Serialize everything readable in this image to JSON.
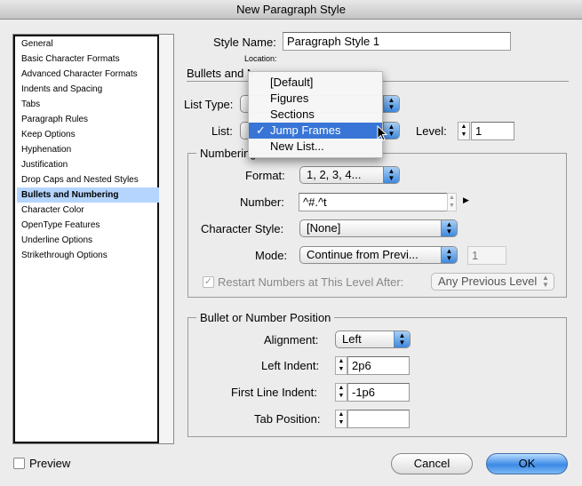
{
  "window": {
    "title": "New Paragraph Style"
  },
  "sidebar": {
    "items": [
      {
        "label": "General"
      },
      {
        "label": "Basic Character Formats"
      },
      {
        "label": "Advanced Character Formats"
      },
      {
        "label": "Indents and Spacing"
      },
      {
        "label": "Tabs"
      },
      {
        "label": "Paragraph Rules"
      },
      {
        "label": "Keep Options"
      },
      {
        "label": "Hyphenation"
      },
      {
        "label": "Justification"
      },
      {
        "label": "Drop Caps and Nested Styles"
      },
      {
        "label": "Bullets and Numbering",
        "selected": true
      },
      {
        "label": "Character Color"
      },
      {
        "label": "OpenType Features"
      },
      {
        "label": "Underline Options"
      },
      {
        "label": "Strikethrough Options"
      }
    ]
  },
  "style_name": {
    "label": "Style Name:",
    "value": "Paragraph Style 1"
  },
  "location_label": "Location:",
  "section_title": "Bullets and Numbering",
  "list_type": {
    "label": "List Type:"
  },
  "list": {
    "label": "List:",
    "value": "Jump Frames"
  },
  "level": {
    "label": "Level:",
    "value": "1"
  },
  "list_menu": {
    "items": [
      "[Default]",
      "Figures",
      "Sections",
      "Jump Frames",
      "New List..."
    ],
    "selected": "Jump Frames",
    "check": "✓"
  },
  "numbering": {
    "title": "Numbering Style",
    "format": {
      "label": "Format:",
      "value": "1, 2, 3, 4..."
    },
    "number": {
      "label": "Number:",
      "value": "^#.^t"
    },
    "char_style": {
      "label": "Character Style:",
      "value": "[None]"
    },
    "mode": {
      "label": "Mode:",
      "value": "Continue from Previ...",
      "start": "1"
    },
    "restart": {
      "label": "Restart Numbers at This Level After:",
      "checked": true,
      "enabled": false,
      "value": "Any Previous Level"
    }
  },
  "position": {
    "title": "Bullet or Number Position",
    "alignment": {
      "label": "Alignment:",
      "value": "Left"
    },
    "left_indent": {
      "label": "Left Indent:",
      "value": "2p6"
    },
    "first_line_indent": {
      "label": "First Line Indent:",
      "value": "-1p6"
    },
    "tab_position": {
      "label": "Tab Position:",
      "value": ""
    }
  },
  "preview": {
    "label": "Preview",
    "checked": false
  },
  "buttons": {
    "cancel": "Cancel",
    "ok": "OK"
  },
  "colors": {
    "accent": "#3875d7",
    "selection": "#b5d5ff"
  }
}
